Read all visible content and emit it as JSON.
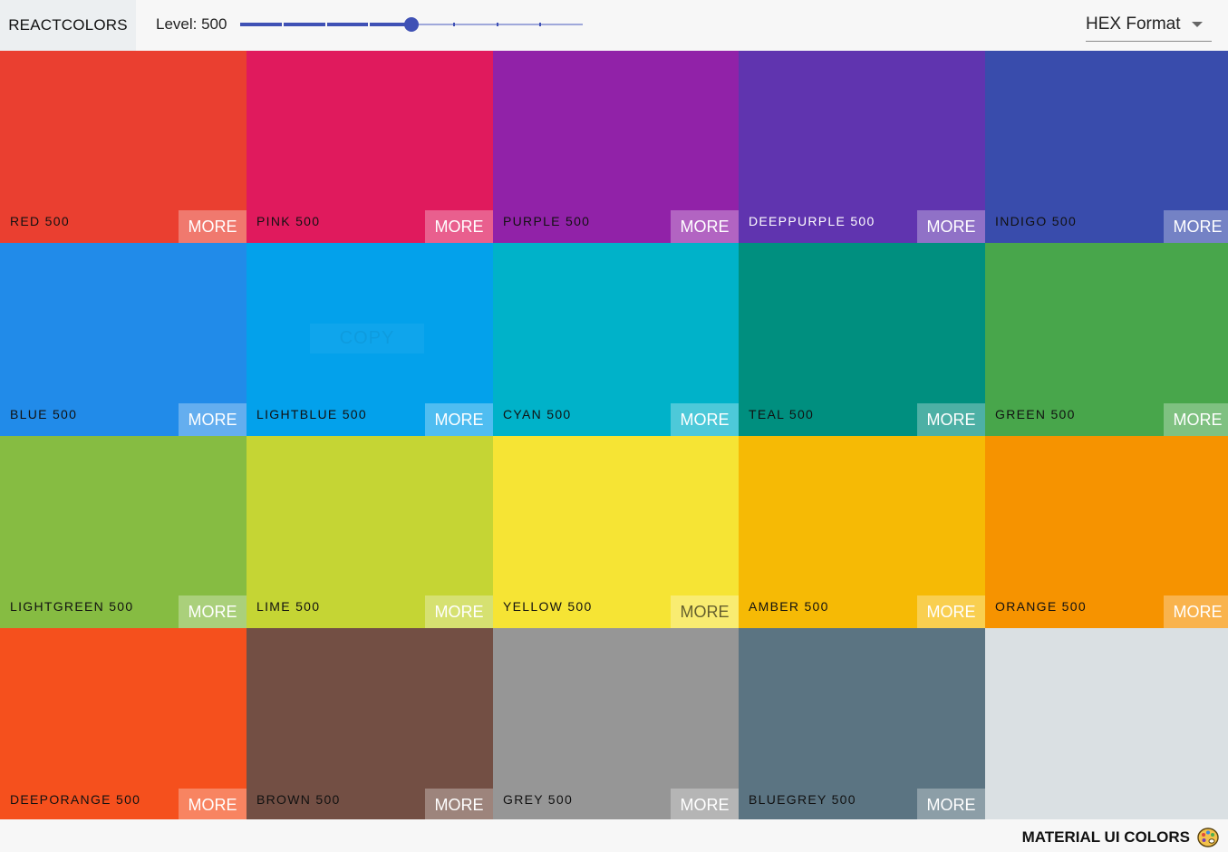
{
  "navbar": {
    "logo": "REACTCOLORS",
    "level_label": "Level: 500",
    "slider": {
      "min": 100,
      "max": 900,
      "step": 100,
      "value": 500
    },
    "format_select": {
      "value": "HEX Format",
      "options": [
        "HEX Format"
      ]
    }
  },
  "copy_overlay": {
    "label": "COPY"
  },
  "colors": [
    {
      "name": "red 500",
      "hex": "#EA3F30",
      "text": "dark",
      "more": "MORE"
    },
    {
      "name": "pink 500",
      "hex": "#E01A5D",
      "text": "dark",
      "more": "MORE"
    },
    {
      "name": "purple 500",
      "hex": "#9122A8",
      "text": "dark",
      "more": "MORE"
    },
    {
      "name": "deeppurple 500",
      "hex": "#6034AF",
      "text": "light",
      "more": "MORE"
    },
    {
      "name": "indigo 500",
      "hex": "#394CAC",
      "text": "dark",
      "more": "MORE"
    },
    {
      "name": "blue 500",
      "hex": "#218BE9",
      "text": "dark",
      "more": "MORE"
    },
    {
      "name": "lightblue 500",
      "hex": "#03A1EB",
      "text": "dark",
      "more": "MORE"
    },
    {
      "name": "cyan 500",
      "hex": "#00B2C9",
      "text": "dark",
      "more": "MORE"
    },
    {
      "name": "teal 500",
      "hex": "#008F7F",
      "text": "dark",
      "more": "MORE"
    },
    {
      "name": "green 500",
      "hex": "#48A64B",
      "text": "dark",
      "more": "MORE"
    },
    {
      "name": "lightgreen 500",
      "hex": "#86BC42",
      "text": "dark",
      "more": "MORE"
    },
    {
      "name": "lime 500",
      "hex": "#C5D534",
      "text": "dark",
      "more": "MORE"
    },
    {
      "name": "yellow 500",
      "hex": "#F6E434",
      "text": "dark",
      "more": "MORE",
      "more_dark": true
    },
    {
      "name": "amber 500",
      "hex": "#F6BA05",
      "text": "dark",
      "more": "MORE"
    },
    {
      "name": "orange 500",
      "hex": "#F69300",
      "text": "dark",
      "more": "MORE"
    },
    {
      "name": "deeporange 500",
      "hex": "#F5501D",
      "text": "dark",
      "more": "MORE"
    },
    {
      "name": "brown 500",
      "hex": "#734F44",
      "text": "dark",
      "more": "MORE"
    },
    {
      "name": "grey 500",
      "hex": "#969696",
      "text": "dark",
      "more": "MORE"
    },
    {
      "name": "bluegrey 500",
      "hex": "#5B7482",
      "text": "dark",
      "more": "MORE"
    },
    {
      "name": "",
      "hex": "#DAE0E3",
      "text": "dark",
      "more": ""
    }
  ],
  "footer": {
    "text": "MATERIAL UI COLORS",
    "icon": "palette-icon"
  }
}
